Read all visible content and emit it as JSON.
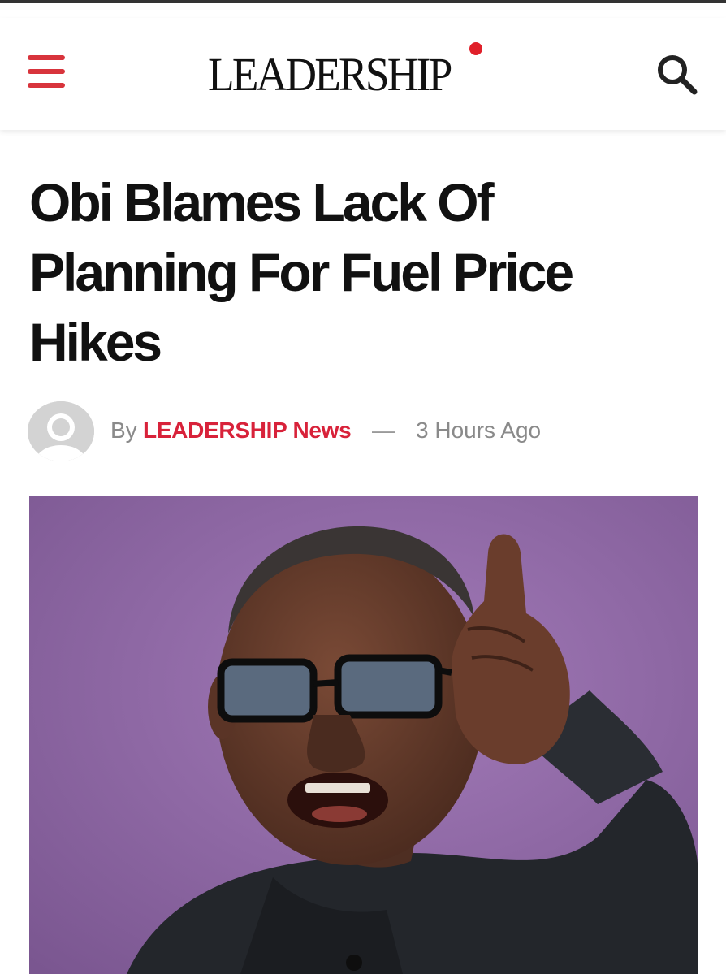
{
  "header": {
    "logo_text": "LEADERSHIP",
    "menu_icon": "hamburger-menu-icon",
    "search_icon": "search-icon",
    "accent_color": "#d8343c"
  },
  "article": {
    "headline": "Obi Blames Lack Of Planning For Fuel Price Hikes",
    "by_label": "By",
    "author": "LEADERSHIP News",
    "separator": "—",
    "timestamp": "3 Hours Ago",
    "author_color": "#d8223a",
    "image_icon": "article-photo"
  }
}
